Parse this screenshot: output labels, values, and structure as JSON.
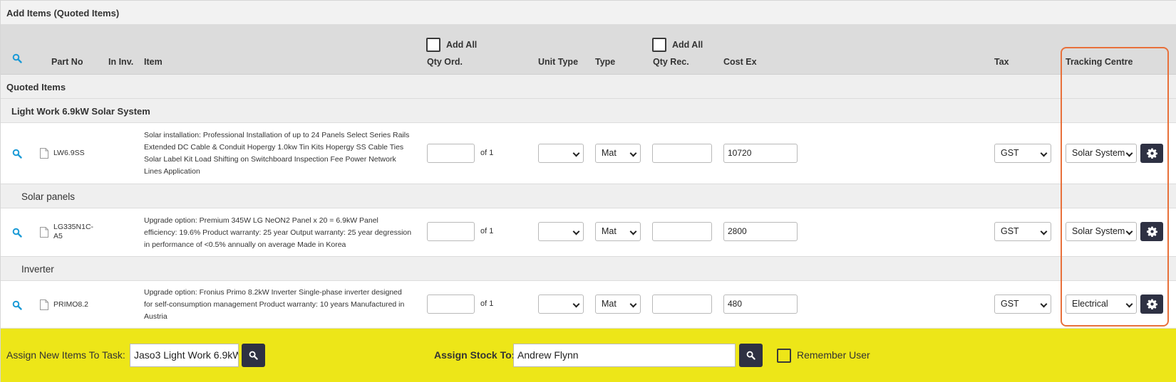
{
  "panel": {
    "title": "Add Items (Quoted Items)"
  },
  "header": {
    "part_no": "Part No",
    "in_inv": "In Inv.",
    "item": "Item",
    "qty_ord": "Qty Ord.",
    "unit_type": "Unit Type",
    "type": "Type",
    "qty_rec": "Qty Rec.",
    "cost_ex": "Cost Ex",
    "tax": "Tax",
    "tracking_centre": "Tracking Centre",
    "add_all_ord": "Add All",
    "add_all_rec": "Add All"
  },
  "quoted_section": "Quoted Items",
  "groups": [
    {
      "title": "Light Work 6.9kW Solar System",
      "item": {
        "part_no": "LW6.9SS",
        "description": "Solar installation: Professional Installation of up to 24 Panels Select Series Rails Extended DC Cable & Conduit Hopergy 1.0kw Tin Kits Hopergy SS Cable Ties Solar Label Kit Load Shifting on Switchboard Inspection Fee Power Network Lines Application",
        "qty_ord": "",
        "of_label": "of 1",
        "unit_type": "",
        "type": "Mat",
        "qty_rec": "",
        "cost_ex": "10720",
        "tax": "GST",
        "tracking": "Solar System"
      }
    },
    {
      "title": "Solar panels",
      "item": {
        "part_no": "LG335N1C-A5",
        "description": "Upgrade option: Premium 345W LG NeON2 Panel x 20 = 6.9kW Panel efficiency: 19.6% Product warranty: 25 year Output warranty: 25 year degression in performance of <0.5% annually on average Made in Korea",
        "qty_ord": "",
        "of_label": "of 1",
        "unit_type": "",
        "type": "Mat",
        "qty_rec": "",
        "cost_ex": "2800",
        "tax": "GST",
        "tracking": "Solar System"
      }
    },
    {
      "title": "Inverter",
      "item": {
        "part_no": "PRIMO8.2",
        "description": "Upgrade option: Fronius Primo 8.2kW Inverter Single-phase inverter designed for self-consumption management Product warranty: 10 years Manufactured in Austria",
        "qty_ord": "",
        "of_label": "of 1",
        "unit_type": "",
        "type": "Mat",
        "qty_rec": "",
        "cost_ex": "480",
        "tax": "GST",
        "tracking": "Electrical"
      }
    }
  ],
  "footer": {
    "assign_task_label": "Assign New Items To Task:",
    "assign_task_value": "Jaso3 Light Work 6.9kW",
    "assign_stock_label": "Assign Stock To:",
    "assign_stock_value": "Andrew Flynn",
    "remember_user_label": "Remember User"
  },
  "colors": {
    "footer_bg": "#ede618",
    "highlight": "#e8703a",
    "button_dark": "#2e3143",
    "search_icon": "#1a9ad6"
  }
}
